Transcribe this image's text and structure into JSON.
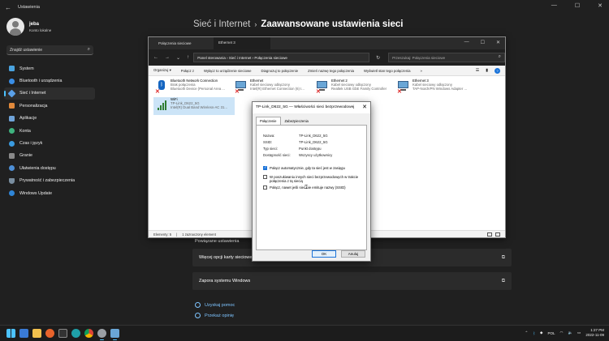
{
  "settings": {
    "window_title": "Ustawienia",
    "user": {
      "name": "jeba",
      "account": "Konto lokalne"
    },
    "search_placeholder": "Znajdź ustawienie",
    "nav": [
      {
        "label": "System",
        "color": "#4aa3df"
      },
      {
        "label": "Bluetooth i urządzenia",
        "color": "#3a8ee6"
      },
      {
        "label": "Sieć i Internet",
        "color": "#5aa0e8"
      },
      {
        "label": "Personalizacja",
        "color": "#e0893b"
      },
      {
        "label": "Aplikacje",
        "color": "#6fa3d8"
      },
      {
        "label": "Konta",
        "color": "#3fb37f"
      },
      {
        "label": "Czas i język",
        "color": "#3a9be0"
      },
      {
        "label": "Granie",
        "color": "#8a8a8a"
      },
      {
        "label": "Ułatwienia dostępu",
        "color": "#4d8fd6"
      },
      {
        "label": "Prywatność i zabezpieczenia",
        "color": "#7a8ea0"
      },
      {
        "label": "Windows Update",
        "color": "#2f86d8"
      }
    ],
    "breadcrumb": {
      "parent": "Sieć i Internet",
      "separator": "›",
      "current": "Zaawansowane ustawienia sieci"
    },
    "section_label": "Powiązane ustawienia",
    "cards": [
      {
        "label": "Więcej opcji karty sieciowej"
      },
      {
        "label": "Zapora systemu Windows"
      }
    ],
    "links": [
      "Uzyskaj pomoc",
      "Przekaż opinię"
    ]
  },
  "netwin": {
    "title": "Połączenia sieciowe",
    "tab_title": "Ethernet 3",
    "address_path": "Panel sterowania  ›  Sieć i Internet  ›  Połączenia sieciowe",
    "search_placeholder": "Przeszukaj: Połączenia sieciowe",
    "toolbar": [
      "Organizuj ▾",
      "Połącz z",
      "Wyłącz to urządzenie sieciowe",
      "Diagnozuj to połączenie",
      "Zmień nazwę tego połączenia",
      "Wyświetl stan tego połączenia",
      "»"
    ],
    "connections": [
      {
        "name": "Bluetooth Network Connection",
        "status": "Brak połączenia",
        "device": "Bluetooth Device (Personal Area ...",
        "type": "bt",
        "disabled": true,
        "selected": false
      },
      {
        "name": "Ethernet",
        "status": "Kabel sieciowy odłączony",
        "device": "Intel(R) Ethernet Connection (6) I...",
        "type": "eth",
        "disabled": true,
        "selected": false
      },
      {
        "name": "Ethernet 2",
        "status": "Kabel sieciowy odłączony",
        "device": "Realtek USB GbE Family Controller",
        "type": "eth",
        "disabled": true,
        "selected": false
      },
      {
        "name": "Ethernet 3",
        "status": "Kabel sieciowy odłączony",
        "device": "TAP-NordVPN Windows Adapter ...",
        "type": "eth",
        "disabled": true,
        "selected": false
      },
      {
        "name": "WiFi",
        "status": "TP-Link_D622_5G",
        "device": "Intel(R) Dual Band Wireless-AC 31...",
        "type": "wifi",
        "disabled": false,
        "selected": true
      }
    ],
    "status_bar": {
      "items": "Elementy: 5",
      "selected": "1 zaznaczony element"
    }
  },
  "dialog": {
    "title": "TP-Link_D622_5G — Właściwości sieci bezprzewodowej",
    "tabs": [
      "Połączenie",
      "Zabezpieczenia"
    ],
    "fields": [
      {
        "key": "Nazwa:",
        "value": "TP-Link_D622_5G"
      },
      {
        "key": "SSID:",
        "value": "TP-Link_D622_5G"
      },
      {
        "key": "Typ sieci:",
        "value": "Punkt dostępu"
      },
      {
        "key": "Dostępność sieci:",
        "value": "Wszyscy użytkownicy"
      }
    ],
    "options": [
      {
        "label": "Połącz automatycznie, gdy ta sieć jest w zasięgu",
        "checked": true
      },
      {
        "label": "W poszukiwaniu innych sieci bezprzewodowych w trakcie połączenia z tą siecią",
        "checked": false
      },
      {
        "label": "Połącz, nawet jeśli sieć nie emituje nazwy (SSID)",
        "checked": false
      }
    ],
    "ok": "OK",
    "cancel": "Anuluj"
  },
  "taskbar": {
    "language": "POL",
    "time": "1:27 PM",
    "date": "2022-11-09"
  }
}
